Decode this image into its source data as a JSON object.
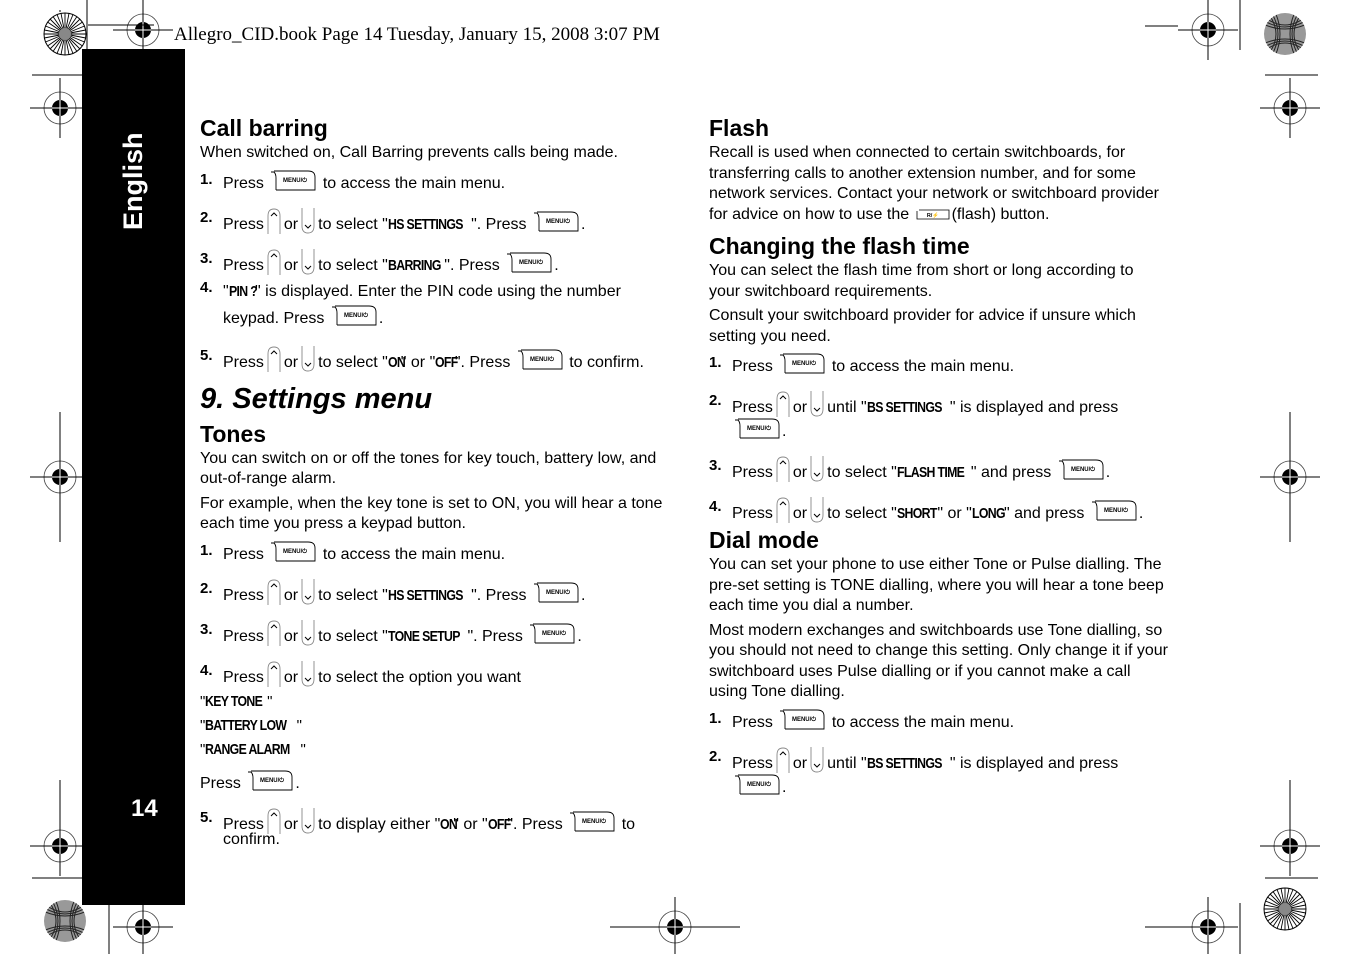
{
  "header": {
    "print_info": "Allegro_CID.book  Page 14  Tuesday, January 15, 2008  3:07 PM"
  },
  "side_tab": {
    "language": "English",
    "page_number": "14"
  },
  "icons": {
    "menu_key": "menu-key-icon",
    "menu_key_label": "MENU/⏻",
    "up_key": "up-arrow-key-icon",
    "down_key": "down-arrow-key-icon",
    "flash_key": "flash-recall-key-icon",
    "flash_key_label": "R/⚡"
  },
  "left": {
    "call_barring": {
      "title": "Call barring",
      "intro": "When switched on, Call Barring prevents calls being made.",
      "steps": [
        {
          "num": "1.",
          "a": "Press",
          "b": "to access the main menu."
        },
        {
          "num": "2.",
          "a": "Press",
          "or": "or",
          "b": "to select \"",
          "lcd": "HS SETTINGS",
          "c": "\". Press",
          "d": "."
        },
        {
          "num": "3.",
          "a": "Press",
          "or": "or",
          "b": "to select \"",
          "lcd": "BARRING",
          "c": "\". Press",
          "d": "."
        },
        {
          "num": "4.",
          "pre": "\"",
          "lcd": "PIN ?",
          "a": "\" is displayed. Enter the PIN code using the number",
          "b": "keypad. Press",
          "d": "."
        },
        {
          "num": "5.",
          "a": "Press",
          "or": "or",
          "b": "to select \"",
          "lcd1": "ON",
          "mid": "\" or \"",
          "lcd2": "OFF",
          "c": "\". Press",
          "d": "to confirm."
        }
      ]
    },
    "settings_menu": {
      "title": "9. Settings menu"
    },
    "tones": {
      "title": "Tones",
      "para1": "You can switch on or off the tones for key touch, battery low, and out-of-range alarm.",
      "para2": "For example, when the key tone is set to ON, you will hear a tone each time you press a keypad button.",
      "steps": [
        {
          "num": "1.",
          "a": "Press",
          "b": "to access the main menu."
        },
        {
          "num": "2.",
          "a": "Press",
          "or": "or",
          "b": "to select \"",
          "lcd": "HS SETTINGS",
          "c": "\". Press",
          "d": "."
        },
        {
          "num": "3.",
          "a": "Press",
          "or": "or",
          "b": "to select \"",
          "lcd": "TONE SETUP",
          "c": "\". Press",
          "d": "."
        },
        {
          "num": "4.",
          "a": "Press",
          "or": "or",
          "b": "to select the option you want"
        },
        {
          "num": "5.",
          "a": "Press",
          "or": "or",
          "b": "to display either \"",
          "lcd1": "ON",
          "mid": "\" or \"",
          "lcd2": "OFF",
          "c": "\". Press",
          "d": "to",
          "e": "confirm."
        }
      ],
      "options": [
        "KEY TONE",
        "BATTERY LOW",
        "RANGE ALARM"
      ],
      "press_label": "Press",
      "press_end": "."
    }
  },
  "right": {
    "flash": {
      "title": "Flash",
      "para": "Recall is used when connected to certain switchboards, for transferring calls to another extension number, and for some network services. Contact your network or switchboard provider for advice on how to use the",
      "para_end": "(flash) button."
    },
    "flash_time": {
      "title": "Changing the flash time",
      "para1": "You can select the flash time from short or long according to your switchboard requirements.",
      "para2": "Consult your switchboard provider for advice if unsure which setting you need.",
      "steps": [
        {
          "num": "1.",
          "a": "Press",
          "b": "to access the main menu."
        },
        {
          "num": "2.",
          "a": "Press",
          "or": "or",
          "b": "until \"",
          "lcd": "BS SETTINGS",
          "c": "\" is displayed and press",
          "d": "."
        },
        {
          "num": "3.",
          "a": "Press",
          "or": "or",
          "b": "to select \"",
          "lcd": "FLASH TIME",
          "c": "\" and press",
          "d": "."
        },
        {
          "num": "4.",
          "a": "Press",
          "or": "or",
          "b": "to select \"",
          "lcd1": "SHORT",
          "mid": "\" or \"",
          "lcd2": "LONG",
          "c": "\" and press",
          "d": "."
        }
      ]
    },
    "dial_mode": {
      "title": "Dial mode",
      "para1": "You can set your phone to use either Tone or Pulse dialling. The pre-set setting is TONE dialling, where you will hear a tone beep each time you dial a number.",
      "para2": "Most modern exchanges and switchboards use Tone dialling, so you should not need to change this setting. Only change it if your switchboard uses Pulse dialling or if you cannot make a call using Tone dialling.",
      "steps": [
        {
          "num": "1.",
          "a": "Press",
          "b": "to access the main menu."
        },
        {
          "num": "2.",
          "a": "Press",
          "or": "or",
          "b": "until \"",
          "lcd": "BS SETTINGS",
          "c": "\" is displayed and press",
          "d": "."
        }
      ]
    }
  }
}
